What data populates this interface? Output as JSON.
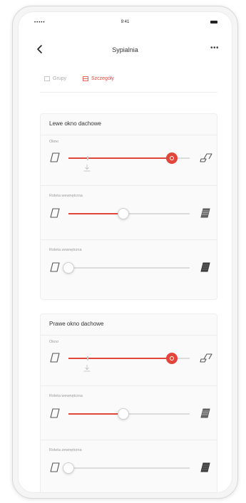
{
  "status_bar": {
    "signal": "•••••",
    "time": "9:41"
  },
  "nav": {
    "title": "Sypialnia",
    "more": "•••"
  },
  "tabs": {
    "groups": "Grupy",
    "details": "Szczegóły"
  },
  "colors": {
    "accent": "#e2463a",
    "track": "#dcdcdc"
  },
  "cards": [
    {
      "title": "Lewe okno dachowe",
      "rows": [
        {
          "label": "Okno",
          "value_percent": 85,
          "marker_percent": 15,
          "icon_left": "window-closed-icon",
          "icon_right": "window-open-icon"
        },
        {
          "label": "Roleta wewnętrzna",
          "value_percent": 45,
          "icon_left": "window-closed-icon",
          "icon_right": "blind-closed-icon"
        },
        {
          "label": "Roleta zewnętrzna",
          "value_percent": 0,
          "icon_left": "window-closed-icon",
          "icon_right": "shutter-closed-icon"
        }
      ]
    },
    {
      "title": "Prawe okno dachowe",
      "rows": [
        {
          "label": "Okno",
          "value_percent": 85,
          "marker_percent": 15,
          "icon_left": "window-closed-icon",
          "icon_right": "window-open-icon"
        },
        {
          "label": "Roleta wewnętrzna",
          "value_percent": 45,
          "icon_left": "window-closed-icon",
          "icon_right": "blind-closed-icon"
        },
        {
          "label": "Roleta zewnętrzna",
          "value_percent": 0,
          "icon_left": "window-closed-icon",
          "icon_right": "shutter-closed-icon"
        }
      ]
    }
  ]
}
